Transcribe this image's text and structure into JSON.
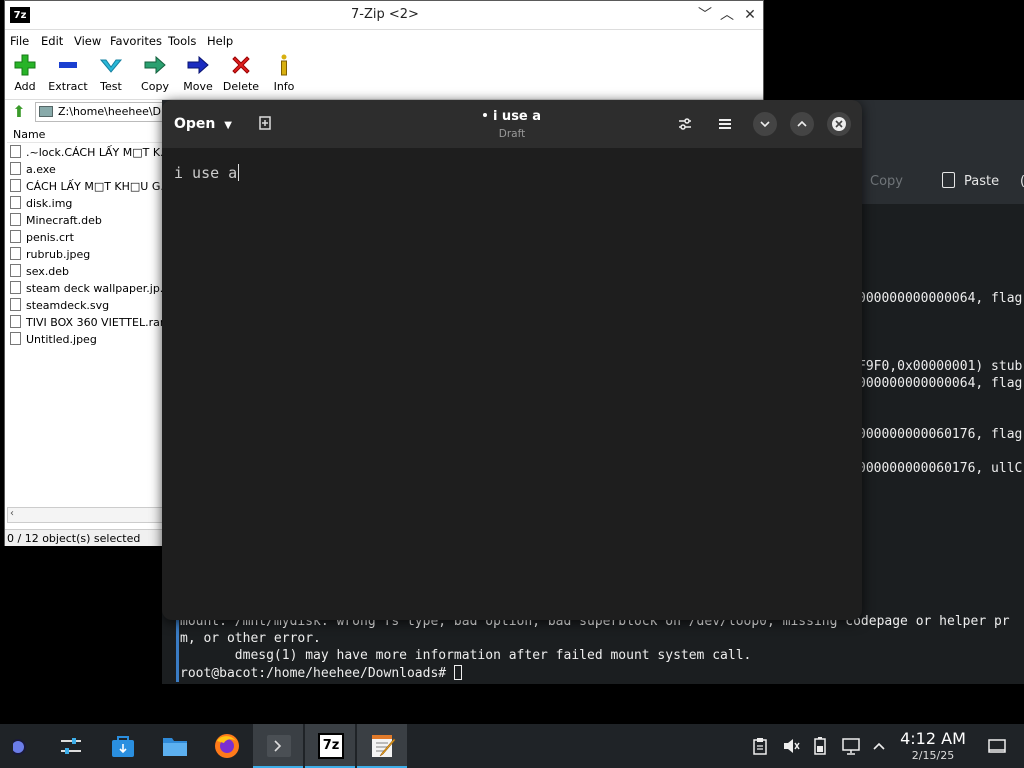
{
  "sevenzip": {
    "logo": "7z",
    "title": "7-Zip <2>",
    "menu": [
      "File",
      "Edit",
      "View",
      "Favorites",
      "Tools",
      "Help"
    ],
    "toolbar": [
      "Add",
      "Extract",
      "Test",
      "Copy",
      "Move",
      "Delete",
      "Info"
    ],
    "path": "Z:\\home\\heehee\\D",
    "column_name": "Name",
    "files": [
      ".~lock.CÁCH LẤY M□T K...",
      "a.exe",
      "CÁCH LẤY M□T KH□U G...",
      "disk.img",
      "Minecraft.deb",
      "penis.crt",
      "rubrub.jpeg",
      "sex.deb",
      "steam deck wallpaper.jp...",
      "steamdeck.svg",
      "TIVI BOX 360 VIETTEL.rar",
      "Untitled.jpeg"
    ],
    "status": "0 / 12 object(s) selected"
  },
  "background_window": {
    "copy_label": "Copy",
    "paste_label": "Paste",
    "right_fragments": [
      "000000000000064, flag",
      "F9F0,0x00000001) stub",
      "000000000000064, flag",
      "000000000060176, flag",
      "000000000060176, ullC"
    ],
    "terminal_lines": [
      "mount: /mnt/mydisk: wrong fs type, bad option, bad superblock on /dev/loop0, missing codepage or helper pr",
      "m, or other error.",
      "       dmesg(1) may have more information after failed mount system call.",
      "root@bacot:/home/heehee/Downloads# "
    ]
  },
  "editor": {
    "open_label": "Open",
    "title": "i use a",
    "subtitle": "Draft",
    "content": "i use a"
  },
  "taskbar": {
    "time": "4:12 AM",
    "date": "2/15/25",
    "sevenzip_label": "7z"
  }
}
